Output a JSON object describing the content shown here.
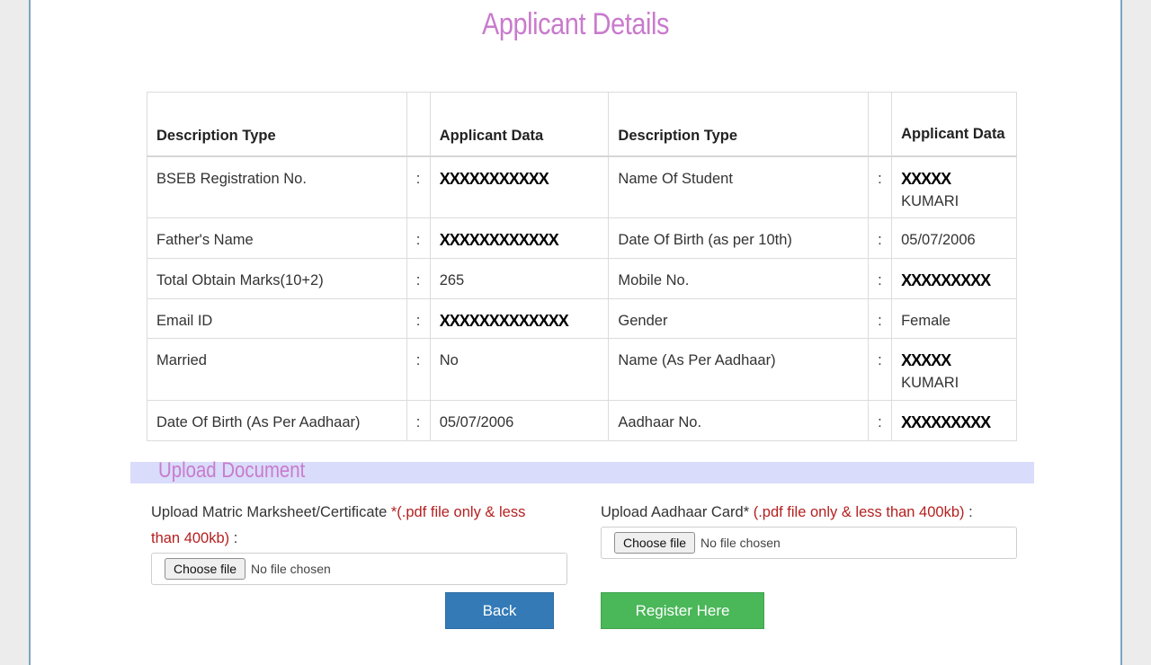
{
  "page": {
    "title": "Applicant Details"
  },
  "table": {
    "headers": [
      "Description Type",
      "Applicant Data",
      "Description Type",
      "Applicant Data"
    ],
    "rows": [
      {
        "l_label": "BSEB Registration No.",
        "l_value": "XXXXXXXXXXX",
        "r_label": "Name Of Student",
        "r_value": "XXXXX",
        "r_value2": "KUMARI"
      },
      {
        "l_label": "Father's Name",
        "l_value": "XXXXXXXXXXXX",
        "r_label": "Date Of Birth (as per 10th)",
        "r_value": "05/07/2006",
        "r_value2": ""
      },
      {
        "l_label": "Total Obtain Marks(10+2)",
        "l_value": "265",
        "r_label": "Mobile No.",
        "r_value": "XXXXXXXXX",
        "r_value2": ""
      },
      {
        "l_label": "Email ID",
        "l_value": "XXXXXXXXXXXXX",
        "r_label": "Gender",
        "r_value": "Female",
        "r_value2": ""
      },
      {
        "l_label": "Married",
        "l_value": "No",
        "r_label": "Name (As Per Aadhaar)",
        "r_value": "XXXXX",
        "r_value2": "KUMARI"
      },
      {
        "l_label": "Date Of Birth (As Per Aadhaar)",
        "l_value": "05/07/2006",
        "r_label": "Aadhaar No.",
        "r_value": "XXXXXXXXX",
        "r_value2": ""
      }
    ],
    "colon": ":"
  },
  "upload": {
    "section_title": "Upload Document",
    "matric_label": "Upload Matric Marksheet/Certificate ",
    "matric_req": "*(.pdf file only & less than 400kb)",
    "matric_tail": " :",
    "aadhaar_label": "Upload Aadhaar Card*",
    "aadhaar_req": " (.pdf file only & less than 400kb)",
    "aadhaar_tail": " :",
    "choose_label": "Choose file",
    "no_file_text": "No file chosen"
  },
  "buttons": {
    "back": "Back",
    "register": "Register Here"
  },
  "colors": {
    "title": "#c97bcd",
    "back": "#337ab7",
    "register": "#4ab759",
    "band": "#d9dcfa",
    "required": "#b52020"
  }
}
